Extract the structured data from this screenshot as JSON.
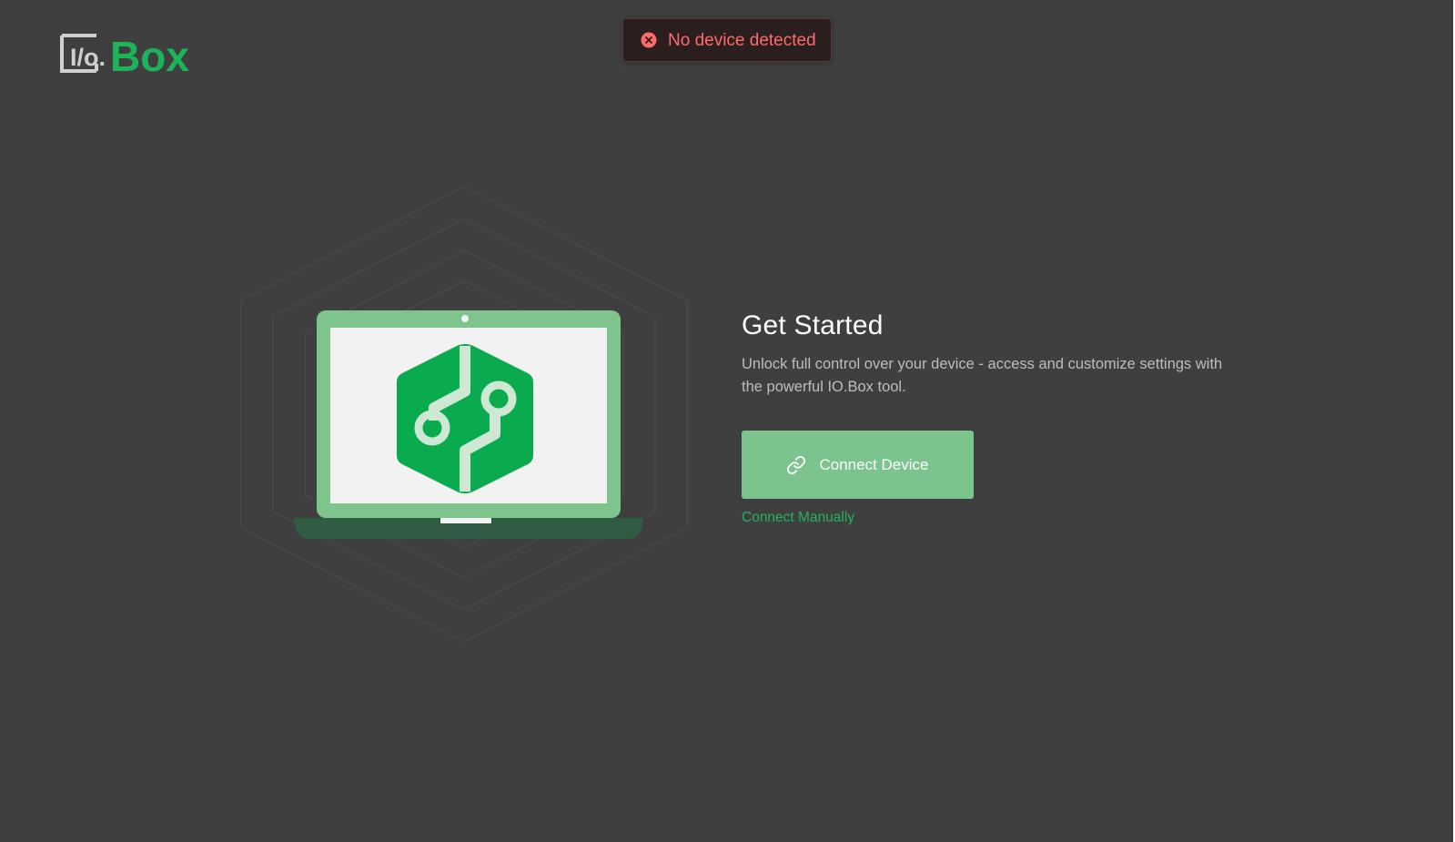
{
  "logo": {
    "io_text": "I/o.",
    "box_text": "Box",
    "io_color": "#cfcfcf",
    "box_color": "#1db35a"
  },
  "toast": {
    "icon": "error-circle-icon",
    "message": "No device detected",
    "color": "#ff6b6b"
  },
  "illustration": {
    "icon": "laptop-circuit-icon",
    "accent": "#0aaa4f"
  },
  "get_started": {
    "title": "Get Started",
    "description": "Unlock full control over your device - access and customize settings with the powerful IO.Box tool.",
    "connect_button": {
      "label": "Connect Device",
      "icon": "link-icon",
      "color": "#7cc48d"
    },
    "manual_link": {
      "label": "Connect Manually",
      "color": "#22b35a"
    }
  },
  "theme": {
    "background": "#3f3f3f"
  }
}
